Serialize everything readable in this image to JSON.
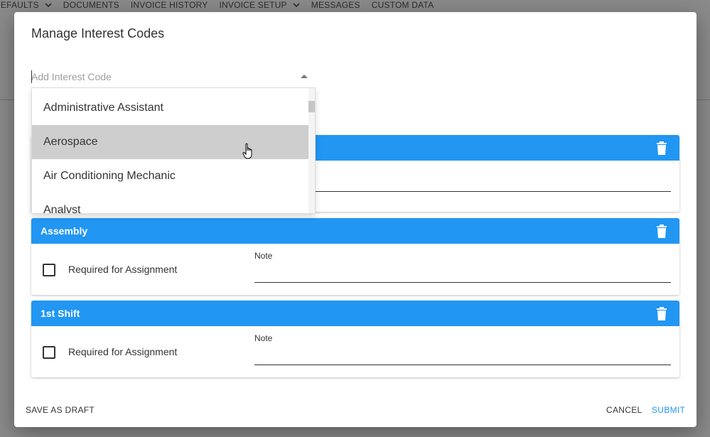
{
  "background_nav": {
    "items": [
      "DEFAULTS",
      "DOCUMENTS",
      "INVOICE HISTORY",
      "INVOICE SETUP",
      "MESSAGES",
      "CUSTOM DATA"
    ]
  },
  "dialog": {
    "title": "Manage Interest Codes",
    "add_field": {
      "placeholder": "Add Interest Code",
      "value": ""
    },
    "dropdown_options": [
      "Administrative Assistant",
      "Aerospace",
      "Air Conditioning Mechanic",
      "Analyst"
    ],
    "hovered_option": "Aerospace",
    "cards": [
      {
        "title": "",
        "checkbox_label": "",
        "note_label": "",
        "note_value": ""
      },
      {
        "title": "Assembly",
        "checkbox_label": "Required for Assignment",
        "note_label": "Note",
        "note_value": ""
      },
      {
        "title": "1st Shift",
        "checkbox_label": "Required for Assignment",
        "note_label": "Note",
        "note_value": ""
      }
    ],
    "footer": {
      "save_draft": "SAVE AS DRAFT",
      "cancel": "CANCEL",
      "submit": "SUBMIT"
    }
  },
  "colors": {
    "accent": "#2196f3",
    "overlay": "#8a8a8a",
    "hover": "#cecece"
  }
}
